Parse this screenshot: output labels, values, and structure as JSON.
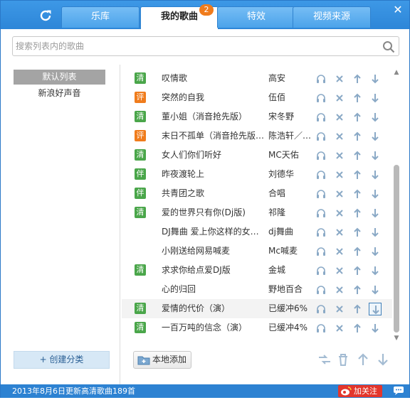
{
  "tabs": [
    {
      "label": "乐库"
    },
    {
      "label": "我的歌曲"
    },
    {
      "label": "特效"
    },
    {
      "label": "视频来源"
    }
  ],
  "tab_badge": "2",
  "search": {
    "placeholder": "搜索列表内的歌曲"
  },
  "sidebar": {
    "items": [
      {
        "label": "默认列表",
        "selected": true
      },
      {
        "label": "新浪好声音",
        "selected": false
      }
    ],
    "create_label": "+ 创建分类"
  },
  "songs": [
    {
      "badge": "清",
      "badge_type": "qing",
      "name": "叹情歌",
      "artist": "高安"
    },
    {
      "badge": "评",
      "badge_type": "ping",
      "name": "突然的自我",
      "artist": "伍佰"
    },
    {
      "badge": "清",
      "badge_type": "qing",
      "name": "董小姐（消音抢先版）",
      "artist": "宋冬野"
    },
    {
      "badge": "评",
      "badge_type": "ping",
      "name": "末日不孤单（消音抢先版…",
      "artist": "陈浩轩／…"
    },
    {
      "badge": "清",
      "badge_type": "qing",
      "name": "女人们你们听好",
      "artist": "MC天佑"
    },
    {
      "badge": "伴",
      "badge_type": "ban",
      "name": "昨夜渡轮上",
      "artist": "刘德华"
    },
    {
      "badge": "伴",
      "badge_type": "ban",
      "name": "共青团之歌",
      "artist": "合唱"
    },
    {
      "badge": "清",
      "badge_type": "qing",
      "name": "爱的世界只有你(Dj版)",
      "artist": "祁隆"
    },
    {
      "badge": "",
      "badge_type": "",
      "name": "DJ舞曲 爱上你这样的女人…",
      "artist": "dj舞曲"
    },
    {
      "badge": "",
      "badge_type": "",
      "name": "小刚送给网易喊麦",
      "artist": "Mc喊麦"
    },
    {
      "badge": "清",
      "badge_type": "qing",
      "name": "求求你给点爱DJ版",
      "artist": "金城"
    },
    {
      "badge": "",
      "badge_type": "",
      "name": "心的归回",
      "artist": "野地百合"
    },
    {
      "badge": "清",
      "badge_type": "qing",
      "name": "爱情的代价（演）",
      "artist": "已缓冲6%"
    },
    {
      "badge": "清",
      "badge_type": "qing",
      "name": "一百万吨的信念（演）",
      "artist": "已缓冲4%"
    }
  ],
  "local_add_label": "本地添加",
  "status_text": "2013年8月6日更新高清歌曲189首",
  "follow_label": "加关注",
  "colors": {
    "titlebar": "#2d86d8",
    "badge_green": "#4aa64a",
    "badge_orange": "#f07c1c",
    "follow_red": "#e3362c"
  },
  "icons": {
    "refresh": "refresh-icon",
    "close": "close-icon",
    "search": "search-icon",
    "listen": "headphones-icon",
    "delete": "x-icon",
    "up": "arrow-up-icon",
    "down": "arrow-down-icon"
  }
}
